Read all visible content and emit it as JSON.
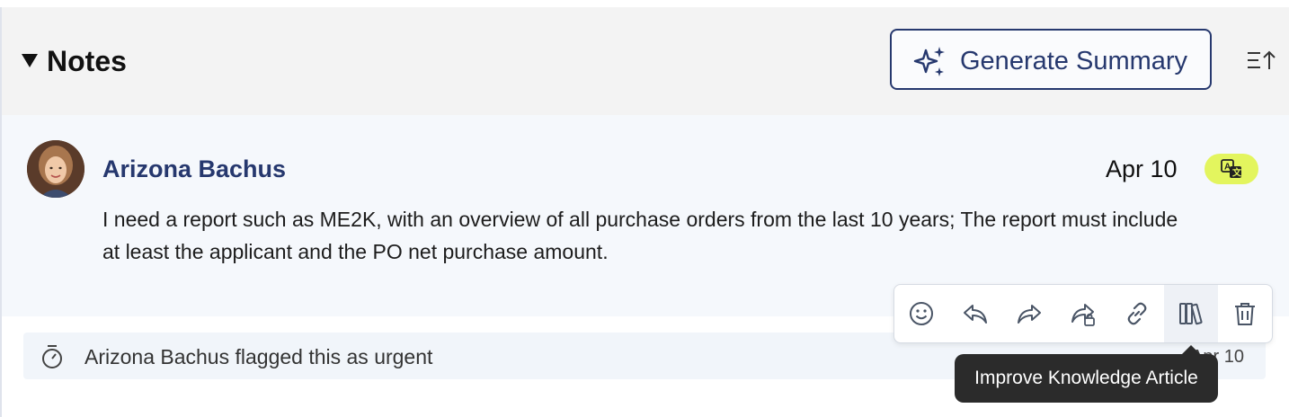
{
  "section": {
    "title": "Notes",
    "generate_button_label": "Generate Summary"
  },
  "note": {
    "author": "Arizona Bachus",
    "date": "Apr 10",
    "body": "I need a report such as ME2K, with an overview of all purchase orders from the last 10 years; The report must include at least the applicant and the PO net purchase amount."
  },
  "activity": {
    "text": "Arizona Bachus flagged this as urgent",
    "date": "Apr 10"
  },
  "toolbar": {
    "icons": [
      "emoji-icon",
      "reply-icon",
      "forward-icon",
      "share-restricted-icon",
      "link-icon",
      "knowledge-article-icon",
      "delete-icon"
    ],
    "tooltip": "Improve Knowledge Article"
  },
  "colors": {
    "accent": "#26386e",
    "translate_badge": "#e3f55e",
    "header_bg": "#f3f3f3",
    "note_bg": "#f5f8fc"
  }
}
